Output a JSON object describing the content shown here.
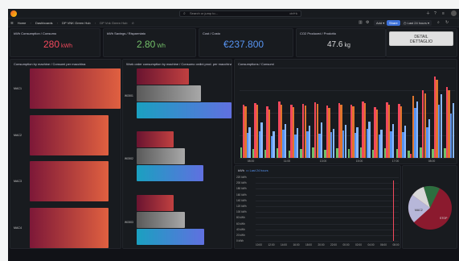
{
  "colors": {
    "accent": "#3d71d9",
    "red": "#f2495c",
    "green": "#73bf69",
    "blue": "#5794f2"
  },
  "topbar": {
    "search_placeholder": "Search or jump to...",
    "search_shortcut": "ctrl+k"
  },
  "subbar": {
    "crumbs": [
      "Home",
      "Dashboards",
      "DP VNK Green Hub",
      "DP Vnk Green Hub"
    ],
    "add_label": "Add",
    "share_label": "Share",
    "time_range": "Last 24 hours"
  },
  "stats": [
    {
      "title": "kWh Consumption / Consumo",
      "value": "280",
      "unit": "kWh",
      "color": "#f2495c"
    },
    {
      "title": "kWh Savings / Risparmiato",
      "value": "2.80",
      "unit": "Wh",
      "color": "#73bf69"
    },
    {
      "title": "Cost / Costo",
      "value": "€237.800",
      "unit": "",
      "color": "#5794f2"
    },
    {
      "title": "CO2 Produced / Prodotto",
      "value": "47.6",
      "unit": "kg",
      "color": "#d8d9da"
    }
  ],
  "detail_button": {
    "line1": "DETAIL",
    "line2": "DETTAGLIO"
  },
  "machines_panel": {
    "title": "Consumption by machine / Consumi per macchina",
    "labels": [
      "MAC1",
      "MAC2",
      "MAC3",
      "MAC4"
    ],
    "values": [
      100,
      87,
      87,
      87
    ]
  },
  "workorder_panel": {
    "title": "Work order consumption by machine / Consumo ordini prod. per macchina",
    "labels": [
      "WO001",
      "WO002",
      "WO003"
    ],
    "values": [
      [
        55,
        68,
        100
      ],
      [
        39,
        51,
        70
      ],
      [
        39,
        51,
        71
      ]
    ]
  },
  "consumptions_panel": {
    "title": "Consumptions / Consumi",
    "xlabels": [
      "08:00",
      "11:00",
      "13:00",
      "15:00",
      "17:00",
      "08:00"
    ]
  },
  "kwh_panel": {
    "title": "kWh",
    "legend": "Last 24 hours",
    "ylabels": [
      "220 kWh",
      "200 kWh",
      "180 kWh",
      "160 kWh",
      "140 kWh",
      "120 kWh",
      "100 kWh",
      "80 kWh",
      "60 kWh",
      "40 kWh",
      "20 kWh",
      "0 kWh"
    ],
    "xlabels": [
      "10:00",
      "12:00",
      "14:00",
      "16:00",
      "18:00",
      "20:00",
      "22:00",
      "00:00",
      "02:00",
      "04:00",
      "06:00",
      "08:00"
    ]
  },
  "pie_panel": {
    "labels": [
      "MAC2",
      "STOP"
    ]
  }
}
